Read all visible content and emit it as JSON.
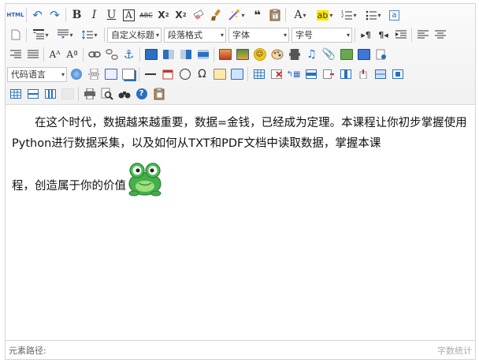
{
  "toolbar": {
    "row1": [
      {
        "name": "html-source-button",
        "glyph": "HTML"
      },
      {
        "name": "undo-button",
        "glyph": "↶"
      },
      {
        "name": "redo-button",
        "glyph": "↷"
      },
      {
        "name": "bold-button",
        "glyph": "B"
      },
      {
        "name": "italic-button",
        "glyph": "I"
      },
      {
        "name": "underline-button",
        "glyph": "U"
      },
      {
        "name": "font-border-button",
        "glyph": "A"
      },
      {
        "name": "strikethrough-button",
        "glyph": "ABC"
      },
      {
        "name": "superscript-button",
        "glyph": "X²"
      },
      {
        "name": "subscript-button",
        "glyph": "X₂"
      },
      {
        "name": "eraser-button",
        "glyph": "⌫"
      },
      {
        "name": "format-painter-button",
        "glyph": "🖌"
      },
      {
        "name": "auto-typeset-button",
        "glyph": "✎"
      },
      {
        "name": "blockquote-button",
        "glyph": "❝❝"
      },
      {
        "name": "paste-plain-button",
        "glyph": "T"
      },
      {
        "name": "font-color-button",
        "glyph": "A"
      },
      {
        "name": "highlight-color-button",
        "glyph": "ab"
      },
      {
        "name": "ordered-list-button",
        "glyph": "⒈≡"
      },
      {
        "name": "unordered-list-button",
        "glyph": "•≡"
      },
      {
        "name": "select-all-button",
        "glyph": "a"
      }
    ],
    "selects": {
      "custom_title": "自定义标题",
      "paragraph": "段落格式",
      "font_family": "字体",
      "font_size": "字号",
      "code_lang": "代码语言"
    }
  },
  "content": {
    "paragraph1": "在这个时代，数据越来越重要，数据=金钱，已经成为定理。本课程让你初步掌握使用Python进行数据采集，以及如何从TXT和PDF文档中读取数据，掌握本课",
    "paragraph2": "程，创造属于你的价值"
  },
  "status": {
    "path_label": "元素路径:",
    "word_count": "字数统计"
  },
  "colors": {
    "frog": "#3fb34f",
    "accent": "#2a6fc1"
  }
}
